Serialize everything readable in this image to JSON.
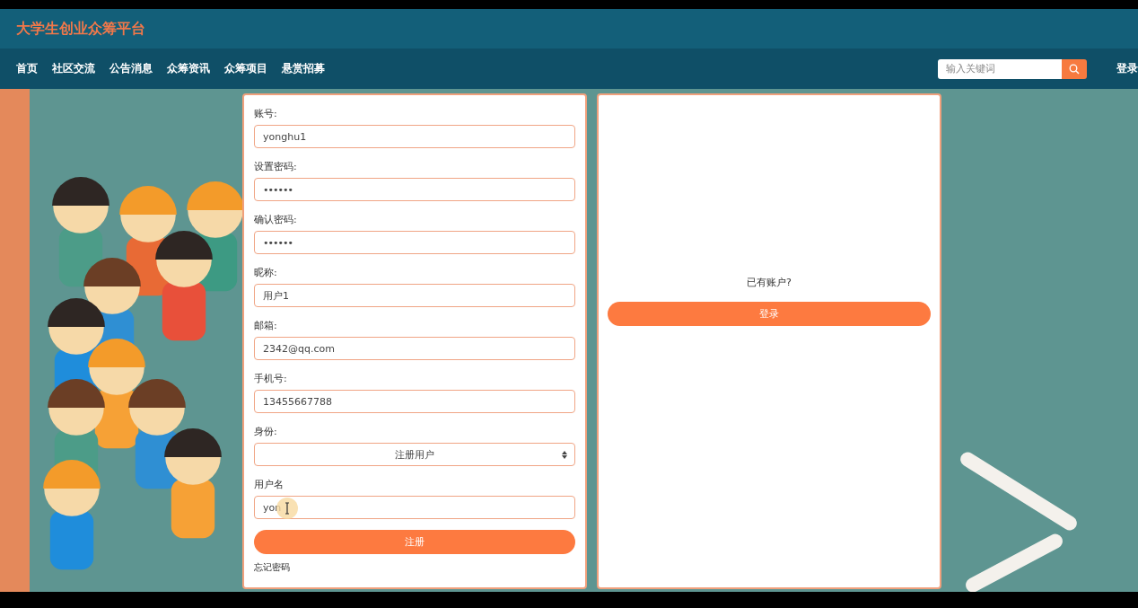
{
  "header": {
    "title": "大学生创业众筹平台"
  },
  "nav": {
    "items": [
      {
        "label": "首页"
      },
      {
        "label": "社区交流"
      },
      {
        "label": "公告消息"
      },
      {
        "label": "众筹资讯"
      },
      {
        "label": "众筹项目"
      },
      {
        "label": "悬赏招募"
      }
    ],
    "search": {
      "placeholder": "输入关键词"
    },
    "login": "登录"
  },
  "register_form": {
    "fields": [
      {
        "label": "账号:",
        "kind": "text",
        "value": "yonghu1"
      },
      {
        "label": "设置密码:",
        "kind": "password",
        "value": "••••••"
      },
      {
        "label": "确认密码:",
        "kind": "password",
        "value": "••••••"
      },
      {
        "label": "昵称:",
        "kind": "text",
        "value": "用户1"
      },
      {
        "label": "邮箱:",
        "kind": "text",
        "value": "2342@qq.com"
      },
      {
        "label": "手机号:",
        "kind": "text",
        "value": "13455667788"
      },
      {
        "label": "身份:",
        "kind": "select",
        "value": "注册用户"
      },
      {
        "label": "用户名",
        "kind": "text",
        "value": "yon",
        "focused": true
      }
    ],
    "submit": "注册",
    "forgot": "忘记密码"
  },
  "login_panel": {
    "prompt": "已有账户?",
    "button": "登录"
  }
}
